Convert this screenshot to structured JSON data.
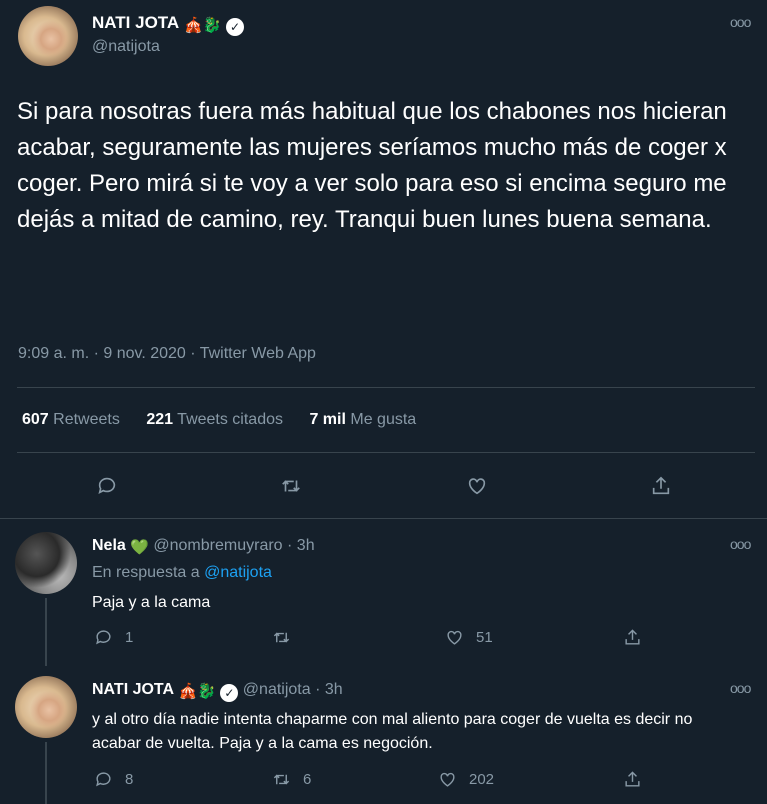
{
  "main_tweet": {
    "display_name": "NATI JOTA",
    "name_emojis": "🎪🐉",
    "verified_mark": "✓",
    "handle": "@natijota",
    "text": "Si para nosotras fuera más habitual que los chabones nos hicieran acabar, seguramente las mujeres seríamos mucho más de coger x coger. Pero mirá si te voy a ver solo para eso si encima seguro me dejás a mitad de camino, rey. Tranqui buen lunes buena semana.",
    "meta": "9:09 a. m. · 9 nov. 2020 · Twitter Web App",
    "stats": {
      "retweets_count": "607",
      "retweets_label": "Retweets",
      "quotes_count": "221",
      "quotes_label": "Tweets citados",
      "likes_count": "7 mil",
      "likes_label": "Me gusta"
    },
    "more_glyph": "ooo"
  },
  "replies": [
    {
      "display_name": "Nela",
      "name_emoji": "💚",
      "handle": "@nombremuyraro",
      "dot": "·",
      "time": "3h",
      "in_reply_prefix": "En respuesta a",
      "in_reply_handle": "@natijota",
      "text": "Paja y a la cama",
      "reply_count": "1",
      "retweet_count": "",
      "like_count": "51",
      "more_glyph": "ooo"
    },
    {
      "display_name": "NATI JOTA",
      "name_emojis": "🎪🐉",
      "verified_mark": "✓",
      "handle": "@natijota",
      "dot": "·",
      "time": "3h",
      "text": "y al otro día nadie intenta chaparme con mal aliento para coger de vuelta es decir no acabar de vuelta. Paja y a la cama es negoción.",
      "reply_count": "8",
      "retweet_count": "6",
      "like_count": "202",
      "more_glyph": "ooo"
    }
  ],
  "icons": {
    "reply": "reply-icon",
    "retweet": "retweet-icon",
    "like": "heart-icon",
    "share": "share-icon",
    "verified": "verified-badge-icon",
    "more": "more-icon"
  },
  "colors": {
    "background": "#15202b",
    "muted": "#8899a6",
    "link": "#1da1f2",
    "divider": "#38444d"
  }
}
